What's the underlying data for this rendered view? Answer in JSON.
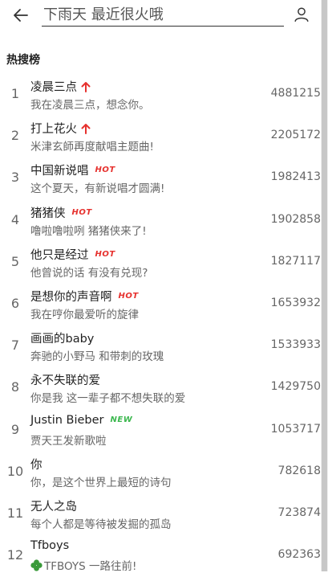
{
  "header": {
    "search_value": "下雨天 最近很火哦",
    "back_icon": "arrow-left-icon",
    "user_icon": "user-icon"
  },
  "section_title": "热搜榜",
  "items": [
    {
      "rank": "1",
      "title": "凌晨三点",
      "subtitle": "我在凌晨三点，想念你。",
      "count": "4881215",
      "badge": "up"
    },
    {
      "rank": "2",
      "title": "打上花火",
      "subtitle": "米津玄師再度献唱主题曲!",
      "count": "2205172",
      "badge": "up"
    },
    {
      "rank": "3",
      "title": "中国新说唱",
      "subtitle": "这个夏天，有新说唱才圆满!",
      "count": "1982413",
      "badge": "hot"
    },
    {
      "rank": "4",
      "title": "猪猪侠",
      "subtitle": "噜啦噜啦咧 猪猪侠来了!",
      "count": "1902858",
      "badge": "hot"
    },
    {
      "rank": "5",
      "title": "他只是经过",
      "subtitle": "他曾说的话 有没有兑现?",
      "count": "1827117",
      "badge": "hot"
    },
    {
      "rank": "6",
      "title": "是想你的声音啊",
      "subtitle": "我在哼你最爱听的旋律",
      "count": "1653932",
      "badge": "hot"
    },
    {
      "rank": "7",
      "title": "画画的baby",
      "subtitle": "奔驰的小野马 和带刺的玫瑰",
      "count": "1533933",
      "badge": ""
    },
    {
      "rank": "8",
      "title": "永不失联的爱",
      "subtitle": "你是我 这一辈子都不想失联的爱",
      "count": "1429750",
      "badge": ""
    },
    {
      "rank": "9",
      "title": "Justin Bieber",
      "subtitle": "贾天王发新歌啦",
      "count": "1053717",
      "badge": "new"
    },
    {
      "rank": "10",
      "title": "你",
      "subtitle": "你，是这个世界上最短的诗句",
      "count": "782618",
      "badge": ""
    },
    {
      "rank": "11",
      "title": "无人之岛",
      "subtitle": "每个人都是等待被发掘的孤岛",
      "count": "723874",
      "badge": ""
    },
    {
      "rank": "12",
      "title": "Tfboys",
      "subtitle": "TFBOYS 一路往前!",
      "count": "692363",
      "badge": "",
      "subtitle_icon": "clover-icon"
    }
  ],
  "badges": {
    "hot": "HOT",
    "new": "NEW"
  },
  "colors": {
    "hot": "#e6312e",
    "new": "#3cb84f",
    "up": "#e6312e"
  }
}
